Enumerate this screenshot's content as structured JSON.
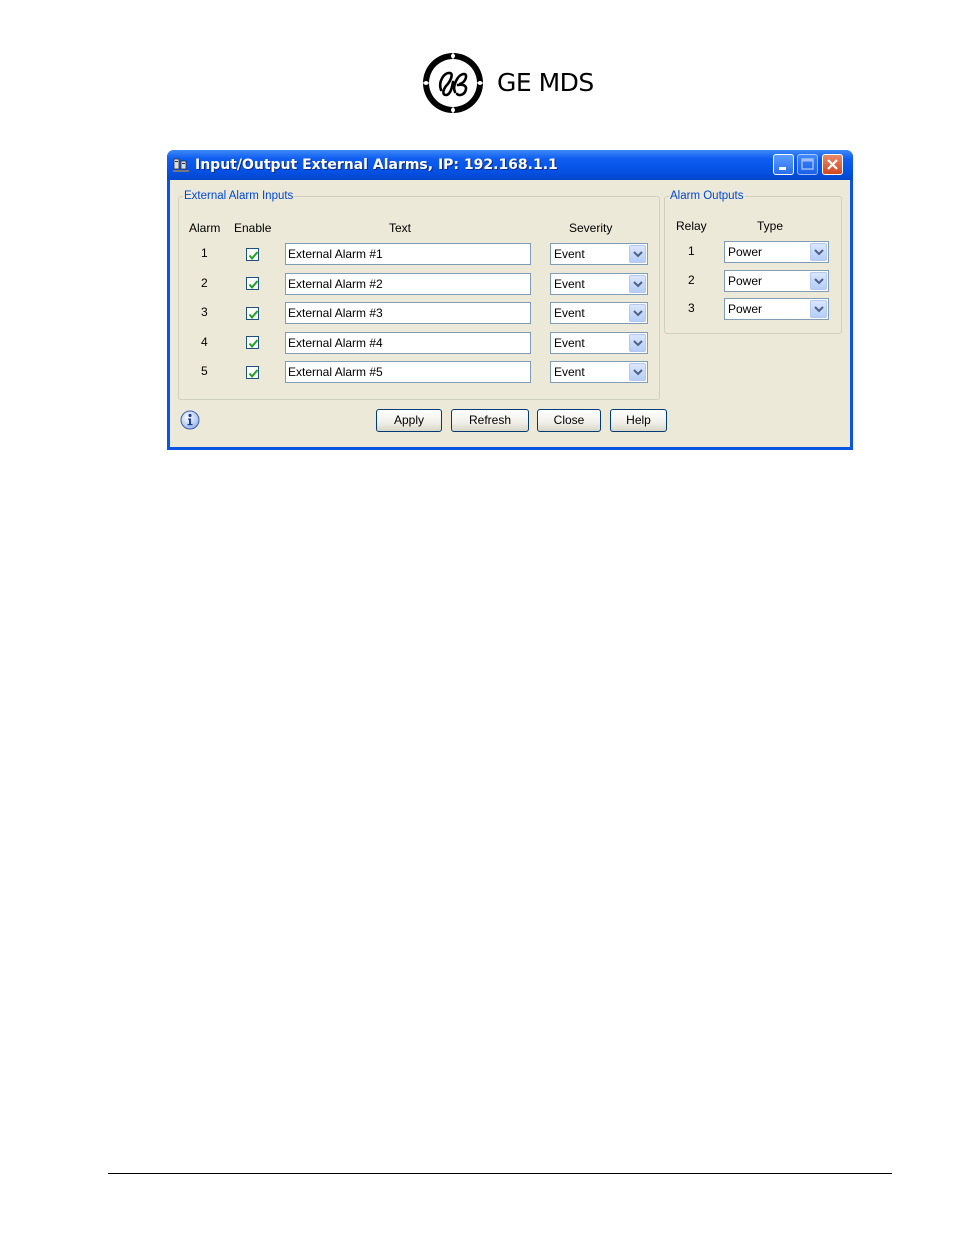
{
  "header": {
    "brand": "GE MDS",
    "logo_icon": "ge-monogram-logo"
  },
  "window": {
    "title": "Input/Output External Alarms, IP: 192.168.1.1",
    "accent_color": "#0a54e4"
  },
  "inputs": {
    "legend": "External Alarm Inputs",
    "col_alarm": "Alarm",
    "col_enable": "Enable",
    "col_text": "Text",
    "col_severity": "Severity",
    "rows": [
      {
        "alarm": "1",
        "enabled": true,
        "text": "External Alarm #1",
        "severity": "Event"
      },
      {
        "alarm": "2",
        "enabled": true,
        "text": "External Alarm #2",
        "severity": "Event"
      },
      {
        "alarm": "3",
        "enabled": true,
        "text": "External Alarm #3",
        "severity": "Event"
      },
      {
        "alarm": "4",
        "enabled": true,
        "text": "External Alarm #4",
        "severity": "Event"
      },
      {
        "alarm": "5",
        "enabled": true,
        "text": "External Alarm #5",
        "severity": "Event"
      }
    ]
  },
  "outputs": {
    "legend": "Alarm Outputs",
    "col_relay": "Relay",
    "col_type": "Type",
    "rows": [
      {
        "relay": "1",
        "type": "Power"
      },
      {
        "relay": "2",
        "type": "Power"
      },
      {
        "relay": "3",
        "type": "Power"
      }
    ]
  },
  "buttons": {
    "apply": "Apply",
    "refresh": "Refresh",
    "close": "Close",
    "help": "Help"
  }
}
